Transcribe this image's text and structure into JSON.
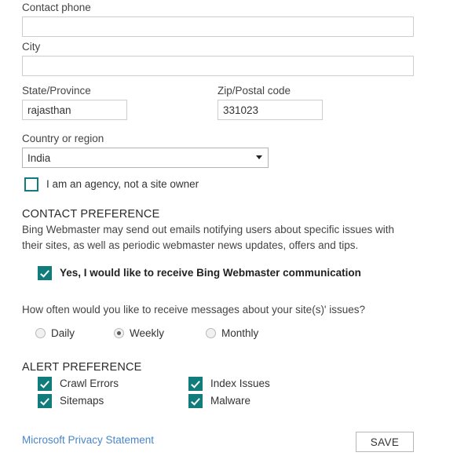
{
  "fields": {
    "contact_phone": {
      "label": "Contact phone",
      "value": "",
      "placeholder": ""
    },
    "city": {
      "label": "City",
      "value": "",
      "placeholder": ""
    },
    "state": {
      "label": "State/Province",
      "value": "rajasthan",
      "placeholder": ""
    },
    "zip": {
      "label": "Zip/Postal code",
      "value": "331023",
      "placeholder": ""
    },
    "country": {
      "label": "Country or region",
      "value": "India",
      "options": [
        "India"
      ]
    }
  },
  "agency": {
    "label": "I am an agency, not a site owner",
    "checked": false
  },
  "contact_preference": {
    "heading": "CONTACT PREFERENCE",
    "description": "Bing Webmaster may send out emails notifying users about specific issues with their sites, as well as periodic webmaster news updates, offers and tips.",
    "opt_in_label": "Yes, I would like to receive Bing Webmaster communication",
    "opt_in_checked": true,
    "frequency_question": "How often would you like to receive messages about your site(s)' issues?",
    "frequency_options": [
      {
        "label": "Daily",
        "selected": false
      },
      {
        "label": "Weekly",
        "selected": true
      },
      {
        "label": "Monthly",
        "selected": false
      }
    ]
  },
  "alert_preference": {
    "heading": "ALERT PREFERENCE",
    "items": [
      {
        "label": "Crawl Errors",
        "checked": true
      },
      {
        "label": "Index Issues",
        "checked": true
      },
      {
        "label": "Sitemaps",
        "checked": true
      },
      {
        "label": "Malware",
        "checked": true
      }
    ]
  },
  "footer": {
    "privacy_link": "Microsoft Privacy Statement",
    "save_label": "SAVE"
  },
  "colors": {
    "accent_teal": "#107c7c",
    "link_blue": "#4a86c8",
    "input_border": "#cdcdcd",
    "text": "#333333"
  }
}
